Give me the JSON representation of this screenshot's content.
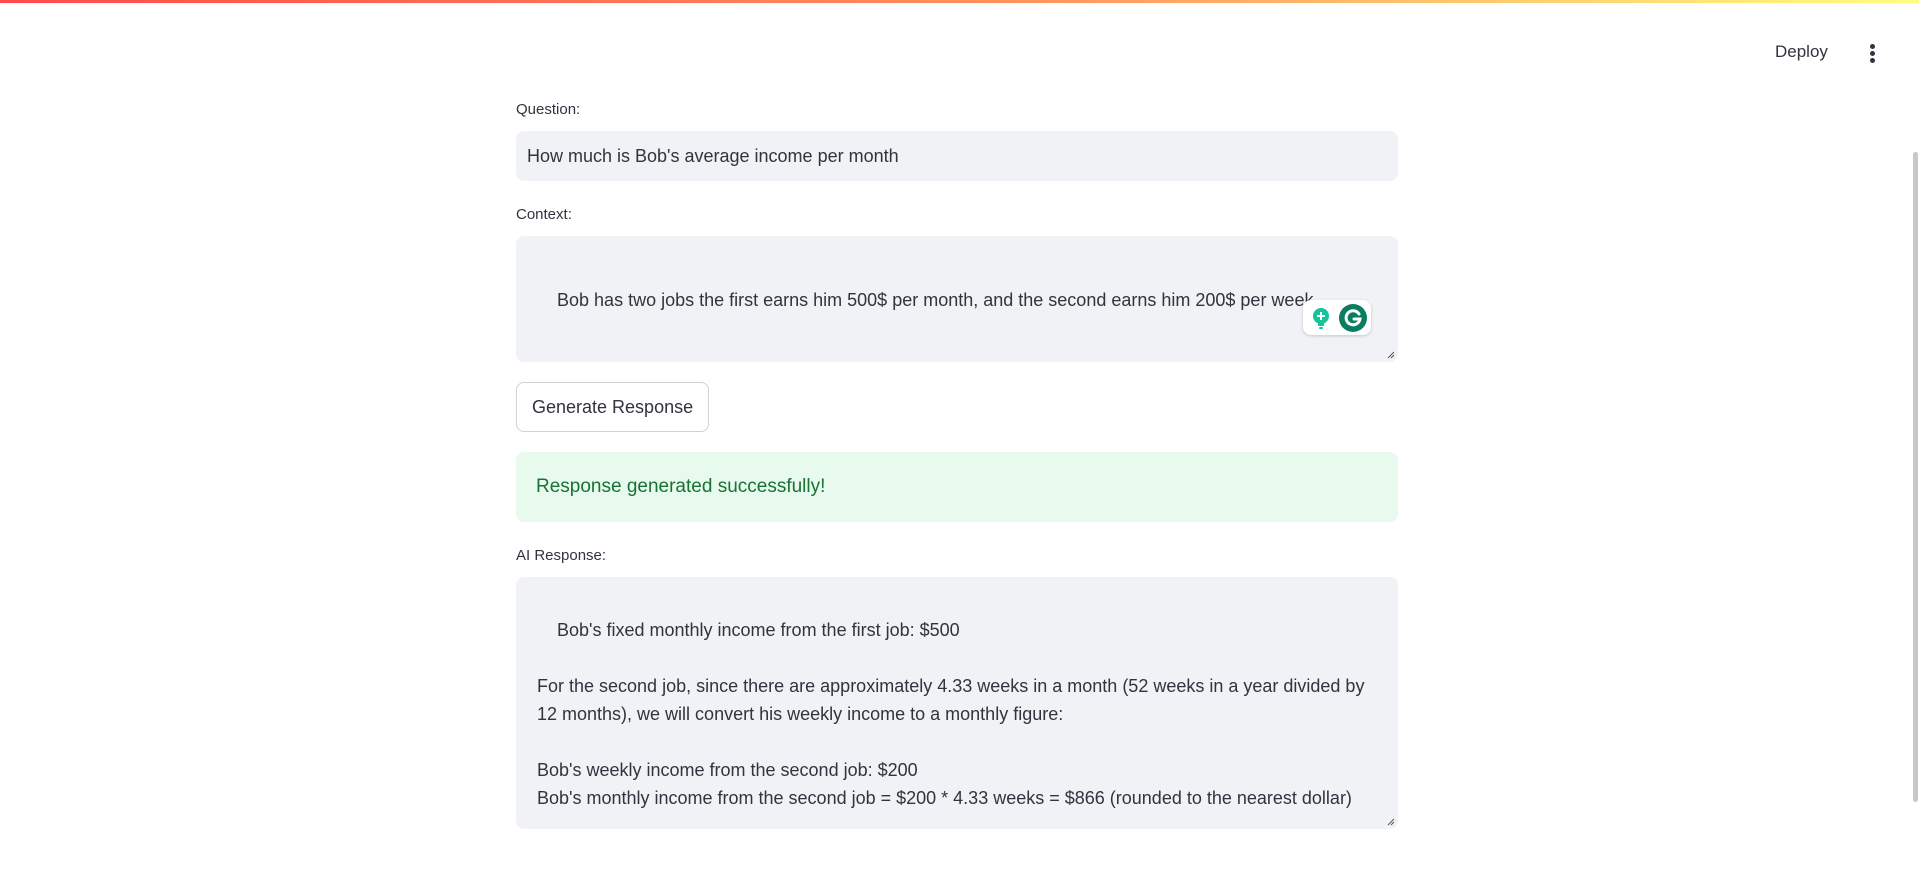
{
  "header": {
    "deploy_label": "Deploy",
    "menu_icon": "vertical-ellipsis-icon"
  },
  "form": {
    "question_label": "Question:",
    "question_value": "How much is Bob's average income per month",
    "context_label": "Context:",
    "context_value": "Bob has two jobs the first earns him 500$ per month, and the second earns him 200$ per week",
    "generate_button": "Generate Response"
  },
  "status": {
    "message": "Response generated successfully!"
  },
  "response": {
    "label": "AI Response:",
    "text": "Bob's fixed monthly income from the first job: $500\n\nFor the second job, since there are approximately 4.33 weeks in a month (52 weeks in a year divided by 12 months), we will convert his weekly income to a monthly figure:\n\nBob's weekly income from the second job: $200\nBob's monthly income from the second job = $200 * 4.33 weeks = $866 (rounded to the nearest dollar)"
  },
  "extension": {
    "bulb_icon": "lightbulb-icon",
    "logo_icon": "grammarly-logo-icon"
  },
  "colors": {
    "accent_gradient_start": "#ff4b4b",
    "accent_gradient_end": "#fffd80",
    "input_bg": "#f0f2f6",
    "success_bg": "#e8f9ee",
    "success_text": "#177233",
    "grammarly_green": "#15c39a",
    "grammarly_dark": "#0a7c5f"
  }
}
